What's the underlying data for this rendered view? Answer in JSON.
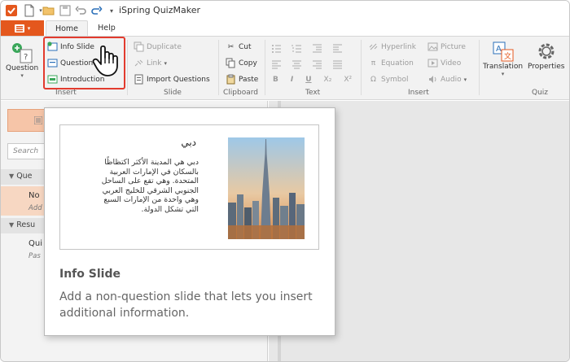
{
  "app": {
    "title": "iSpring QuizMaker"
  },
  "tabs": [
    {
      "label": "Home"
    },
    {
      "label": "Help"
    }
  ],
  "ribbon": {
    "insert_group": {
      "question_label": "Question",
      "info_slide": "Info Slide",
      "question": "Question",
      "introduction": "Introduction",
      "group_label": "Insert"
    },
    "slide_group": {
      "duplicate": "Duplicate",
      "link": "Link",
      "import_questions": "Import Questions",
      "group_label": "Slide"
    },
    "clipboard_group": {
      "cut": "Cut",
      "copy": "Copy",
      "paste": "Paste",
      "group_label": "Clipboard"
    },
    "text_group": {
      "bold": "B",
      "italic": "I",
      "underline": "U",
      "subscript": "X₂",
      "superscript": "X²",
      "group_label": "Text"
    },
    "insert2_group": {
      "hyperlink": "Hyperlink",
      "equation": "Equation",
      "symbol": "Symbol",
      "picture": "Picture",
      "video": "Video",
      "audio": "Audio",
      "group_label": "Insert"
    },
    "quiz_group": {
      "translation": "Translation",
      "properties": "Properties",
      "group_label": "Quiz"
    }
  },
  "left_panel": {
    "search_placeholder": "Search",
    "section_questions": "Que",
    "item1_title": "No",
    "item1_sub": "Add",
    "section_results": "Resu",
    "item2_title": "Qui",
    "item2_sub": "Pas"
  },
  "tooltip": {
    "preview_title_ar": "دبي",
    "preview_body_ar": [
      "دبي هي المدينة الأكثر اكتظاظًا",
      "بالسكان في الإمارات العربية",
      "المتحدة. وهي تقع على الساحل",
      "الجنوبي الشرقي للخليج العربي",
      "وهي واحدة من الإمارات السبع",
      "التي تشكل الدولة."
    ],
    "title": "Info Slide",
    "description": "Add a non-question slide that lets you insert additional information."
  },
  "colors": {
    "accent": "#e4571d",
    "highlight": "#e23b2e",
    "selected_row": "#f7d7c2"
  }
}
